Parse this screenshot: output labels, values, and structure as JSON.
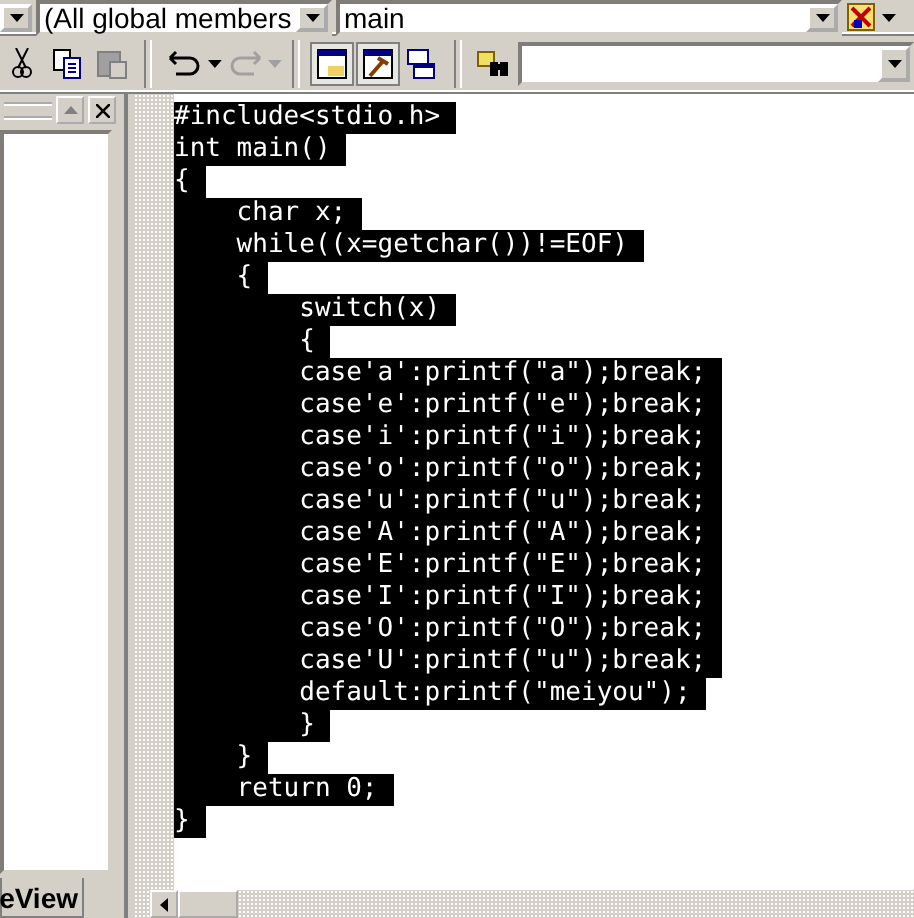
{
  "wizard_bar": {
    "class_combo": {
      "value": "(All global members"
    },
    "member_combo": {
      "value": "main"
    }
  },
  "workspace": {
    "tab": {
      "label": "eView",
      "selected": true
    }
  },
  "editor": {
    "lines": [
      {
        "text": "#include<stdio.h>",
        "selected": true
      },
      {
        "text": "int main()",
        "selected": true
      },
      {
        "text": "{",
        "selected": true
      },
      {
        "text": "    char x;",
        "selected": true
      },
      {
        "text": "    while((x=getchar())!=EOF)",
        "selected": true
      },
      {
        "text": "    {",
        "selected": true
      },
      {
        "text": "        switch(x)",
        "selected": true
      },
      {
        "text": "        {",
        "selected": true
      },
      {
        "text": "        case'a':printf(\"a\");break;",
        "selected": true
      },
      {
        "text": "        case'e':printf(\"e\");break;",
        "selected": true
      },
      {
        "text": "        case'i':printf(\"i\");break;",
        "selected": true
      },
      {
        "text": "        case'o':printf(\"o\");break;",
        "selected": true
      },
      {
        "text": "        case'u':printf(\"u\");break;",
        "selected": true
      },
      {
        "text": "        case'A':printf(\"A\");break;",
        "selected": true
      },
      {
        "text": "        case'E':printf(\"E\");break;",
        "selected": true
      },
      {
        "text": "        case'I':printf(\"I\");break;",
        "selected": true
      },
      {
        "text": "        case'O':printf(\"O\");break;",
        "selected": true
      },
      {
        "text": "        case'U':printf(\"u\");break;",
        "selected": true
      },
      {
        "text": "        default:printf(\"meiyou\");",
        "selected": true
      },
      {
        "text": "        }",
        "selected": true
      },
      {
        "text": "    }",
        "selected": true
      },
      {
        "text": "    return 0;",
        "selected": true
      },
      {
        "text": "}",
        "selected": true
      }
    ]
  }
}
